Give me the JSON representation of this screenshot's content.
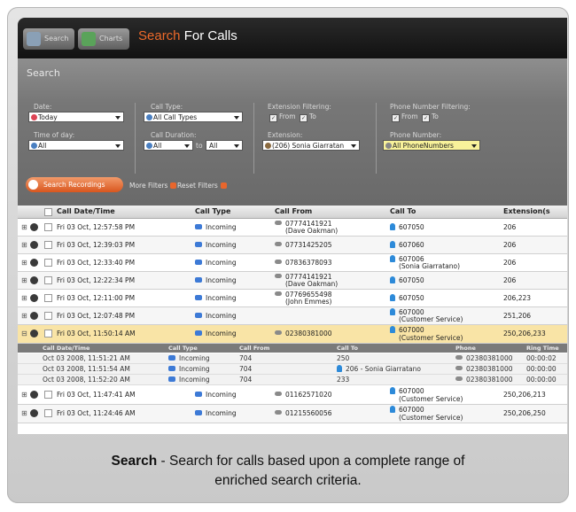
{
  "app": {
    "tab_search": "Search",
    "tab_charts": "Charts",
    "title_highlight": "Search",
    "title_rest": "For Calls"
  },
  "search_panel": {
    "heading": "Search",
    "date_label": "Date:",
    "date_value": "Today",
    "time_label": "Time of day:",
    "time_value": "All",
    "call_type_label": "Call Type:",
    "call_type_value": "All Call Types",
    "duration_label": "Call Duration:",
    "duration_from": "All",
    "duration_to_word": "to",
    "duration_to": "All",
    "ext_filter_label": "Extension Filtering:",
    "ext_from": "From",
    "ext_to": "To",
    "extension_label": "Extension:",
    "extension_value": "(206) Sonia Giarratan",
    "phone_filter_label": "Phone Number Filtering:",
    "phone_from": "From",
    "phone_to": "To",
    "phone_label": "Phone Number:",
    "phone_value": "All PhoneNumbers",
    "search_button": "Search Recordings",
    "more_filters": "More Filters",
    "reset_filters": "Reset Filters"
  },
  "grid": {
    "columns": [
      "Call Date/Time",
      "Call Type",
      "Call From",
      "Call To",
      "Extension(s"
    ],
    "rows": [
      {
        "date": "Fri 03 Oct, 12:57:58 PM",
        "type": "Incoming",
        "from": "07774141921",
        "from_name": "(Dave Oakman)",
        "to": "607050",
        "to_name": "",
        "ext": "206"
      },
      {
        "date": "Fri 03 Oct, 12:39:03 PM",
        "type": "Incoming",
        "from": "07731425205",
        "from_name": "",
        "to": "607060",
        "to_name": "",
        "ext": "206"
      },
      {
        "date": "Fri 03 Oct, 12:33:40 PM",
        "type": "Incoming",
        "from": "07836378093",
        "from_name": "",
        "to": "607006",
        "to_name": "(Sonia Giarratano)",
        "ext": "206"
      },
      {
        "date": "Fri 03 Oct, 12:22:34 PM",
        "type": "Incoming",
        "from": "07774141921",
        "from_name": "(Dave Oakman)",
        "to": "607050",
        "to_name": "",
        "ext": "206"
      },
      {
        "date": "Fri 03 Oct, 12:11:00 PM",
        "type": "Incoming",
        "from": "07769655498",
        "from_name": "(John Emmes)",
        "to": "607050",
        "to_name": "",
        "ext": "206,223"
      },
      {
        "date": "Fri 03 Oct, 12:07:48 PM",
        "type": "Incoming",
        "from": "",
        "from_name": "",
        "to": "607000",
        "to_name": "(Customer Service)",
        "ext": "251,206"
      },
      {
        "date": "Fri 03 Oct, 11:50:14 AM",
        "type": "Incoming",
        "from": "02380381000",
        "from_name": "",
        "to": "607000",
        "to_name": "(Customer Service)",
        "ext": "250,206,233"
      }
    ],
    "sub_columns": [
      "Call Date/Time",
      "Call Type",
      "Call From",
      "Call To",
      "Phone",
      "Ring Time"
    ],
    "sub_rows": [
      {
        "date": "Oct 03 2008, 11:51:21 AM",
        "type": "Incoming",
        "from": "704",
        "to": "250",
        "phone": "02380381000",
        "ring": "00:00:02"
      },
      {
        "date": "Oct 03 2008, 11:51:54 AM",
        "type": "Incoming",
        "from": "704",
        "to": "206 - Sonia Giarratano",
        "phone": "02380381000",
        "ring": "00:00:00"
      },
      {
        "date": "Oct 03 2008, 11:52:20 AM",
        "type": "Incoming",
        "from": "704",
        "to": "233",
        "phone": "02380381000",
        "ring": "00:00:00"
      }
    ],
    "after_rows": [
      {
        "date": "Fri 03 Oct, 11:47:41 AM",
        "type": "Incoming",
        "from": "01162571020",
        "to": "607000",
        "to_name": "(Customer Service)",
        "ext": "250,206,213"
      },
      {
        "date": "Fri 03 Oct, 11:24:46 AM",
        "type": "Incoming",
        "from": "01215560056",
        "to": "607000",
        "to_name": "(Customer Service)",
        "ext": "250,206,250"
      }
    ]
  },
  "caption": {
    "bold": "Search",
    "rest_line1": " - Search for calls based upon a complete range of",
    "line2": "enriched search criteria."
  }
}
